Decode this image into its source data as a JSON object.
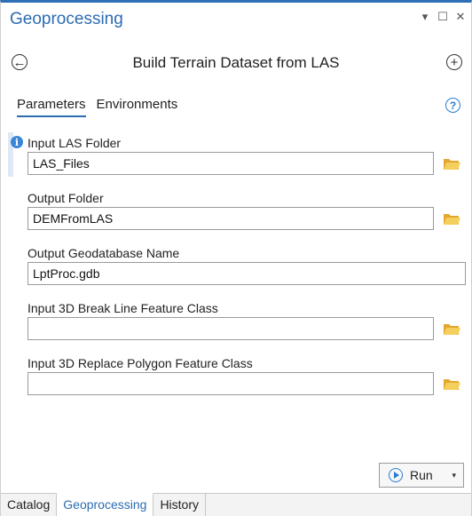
{
  "window": {
    "title": "Geoprocessing",
    "controls": {
      "dropdown": "▾",
      "maximize": "☐",
      "close": "✕"
    }
  },
  "tool": {
    "back_icon": "←",
    "title": "Build Terrain Dataset from LAS",
    "add_icon": "+"
  },
  "tabs": [
    {
      "label": "Parameters",
      "active": true
    },
    {
      "label": "Environments",
      "active": false
    }
  ],
  "help_icon": "?",
  "parameters": [
    {
      "label": "Input LAS Folder",
      "value": "LAS_Files",
      "browse": true,
      "info": true
    },
    {
      "label": "Output Folder",
      "value": "DEMFromLAS",
      "browse": true,
      "info": false
    },
    {
      "label": "Output Geodatabase Name",
      "value": "LptProc.gdb",
      "browse": false,
      "info": false
    },
    {
      "label": "Input 3D Break Line Feature Class",
      "value": "",
      "browse": true,
      "info": false
    },
    {
      "label": "Input 3D Replace Polygon Feature Class",
      "value": "",
      "browse": true,
      "info": false
    }
  ],
  "run_button": {
    "label": "Run",
    "arrow": "▾"
  },
  "bottom_tabs": [
    {
      "label": "Catalog",
      "active": false
    },
    {
      "label": "Geoprocessing",
      "active": true
    },
    {
      "label": "History",
      "active": false
    }
  ],
  "colors": {
    "accent": "#2b6cb3",
    "folder": "#f0c24a",
    "info": "#3a86d6"
  }
}
